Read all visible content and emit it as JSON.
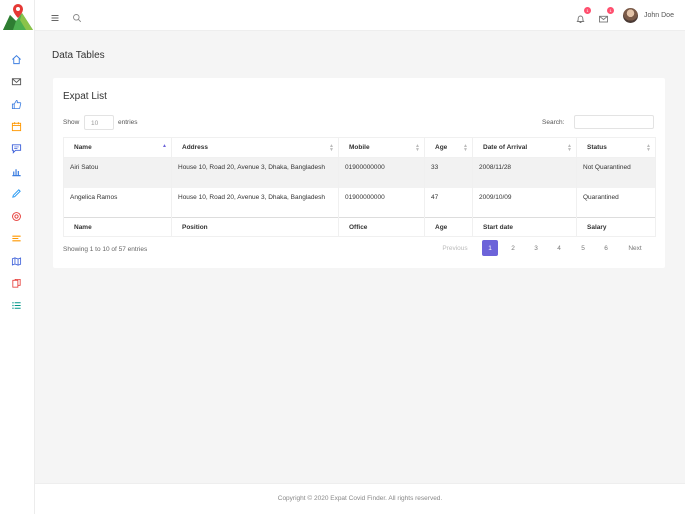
{
  "topbar": {
    "user_name": "John Doe",
    "notifications_count": "1",
    "messages_count": "1"
  },
  "sidebar": {
    "items": [
      {
        "icon": "home-icon"
      },
      {
        "icon": "mail-icon"
      },
      {
        "icon": "thumbs-up-icon"
      },
      {
        "icon": "calendar-icon"
      },
      {
        "icon": "chat-icon"
      },
      {
        "icon": "bar-chart-icon"
      },
      {
        "icon": "pencil-icon"
      },
      {
        "icon": "support-icon"
      },
      {
        "icon": "layers-icon"
      },
      {
        "icon": "map-icon"
      },
      {
        "icon": "documents-icon"
      },
      {
        "icon": "list-icon"
      }
    ]
  },
  "page": {
    "title": "Data Tables"
  },
  "card": {
    "title": "Expat List",
    "show_label": "Show",
    "entries_value": "10",
    "entries_label": "entries",
    "search_label": "Search:"
  },
  "table": {
    "headers": [
      "Name",
      "Address",
      "Mobile",
      "Age",
      "Date of Arrival",
      "Status"
    ],
    "rows": [
      [
        "Airi Satou",
        "House 10, Road 20, Avenue 3, Dhaka, Bangladesh",
        "01900000000",
        "33",
        "2008/11/28",
        "Not Quarantined"
      ],
      [
        "Angelica Ramos",
        "House 10, Road 20, Avenue 3, Dhaka, Bangladesh",
        "01900000000",
        "47",
        "2009/10/09",
        "Quarantined"
      ]
    ],
    "footers": [
      "Name",
      "Position",
      "Office",
      "Age",
      "Start date",
      "Salary"
    ]
  },
  "pagination": {
    "info": "Showing 1 to 10 of 57 entries",
    "previous": "Previous",
    "pages": [
      "1",
      "2",
      "3",
      "4",
      "5",
      "6"
    ],
    "next": "Next",
    "active_page": "1"
  },
  "footer": {
    "copyright": "Copyright © 2020 Expat Covid Finder. All rights reserved."
  },
  "colors": {
    "accent": "#6c63d9",
    "badge": "#ff4f6e",
    "sidebar_icon": "#3b7de0"
  }
}
